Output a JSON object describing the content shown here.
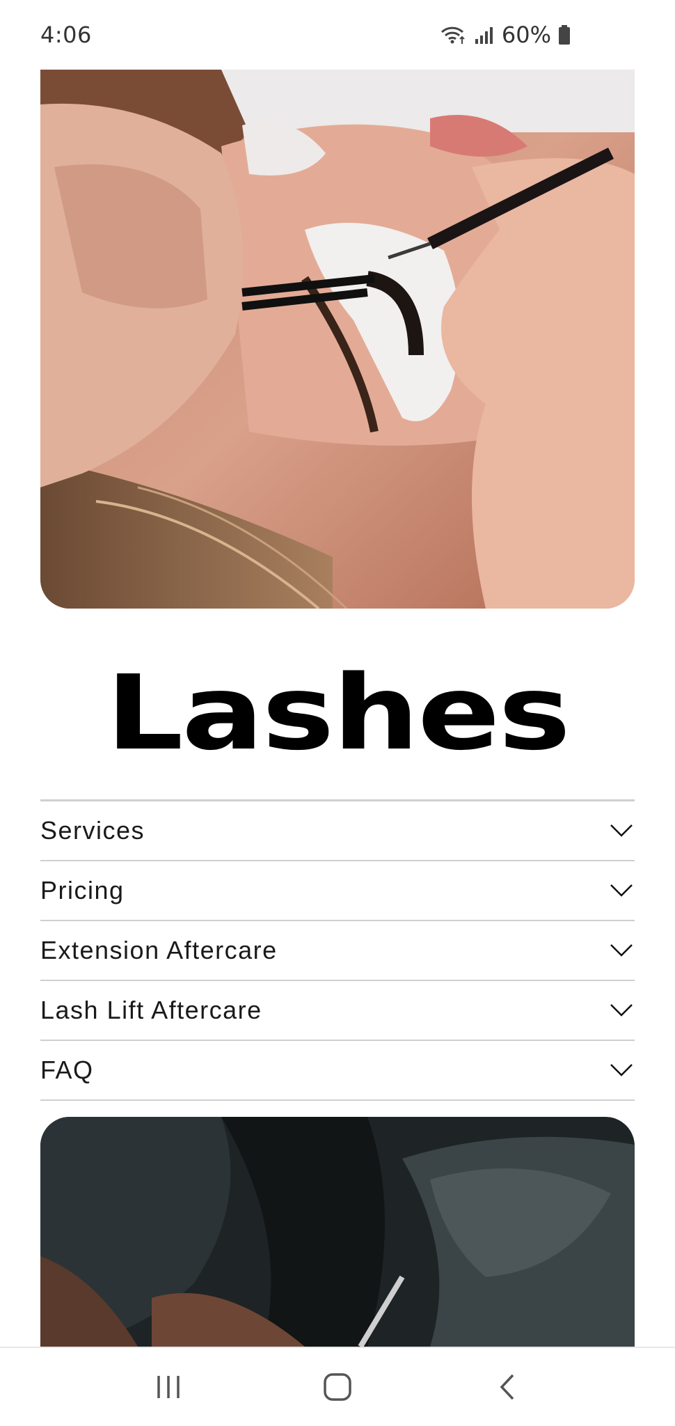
{
  "status_bar": {
    "time": "4:06",
    "battery": "60%",
    "icons": [
      "wifi-icon",
      "cellular-signal-icon",
      "battery-icon"
    ]
  },
  "hero_image": {
    "subject": "lash extension application photo"
  },
  "page": {
    "title": "Lashes"
  },
  "accordion": {
    "items": [
      {
        "label": "Services",
        "icon": "chevron-down-icon"
      },
      {
        "label": "Pricing",
        "icon": "chevron-down-icon"
      },
      {
        "label": "Extension Aftercare",
        "icon": "chevron-down-icon"
      },
      {
        "label": "Lash Lift Aftercare",
        "icon": "chevron-down-icon"
      },
      {
        "label": "FAQ",
        "icon": "chevron-down-icon"
      }
    ]
  },
  "nav_bar": {
    "buttons": [
      "recent-apps-icon",
      "home-icon",
      "back-icon"
    ]
  },
  "colors": {
    "background": "#ffffff",
    "text": "#000000",
    "divider": "#cfcfcf"
  }
}
